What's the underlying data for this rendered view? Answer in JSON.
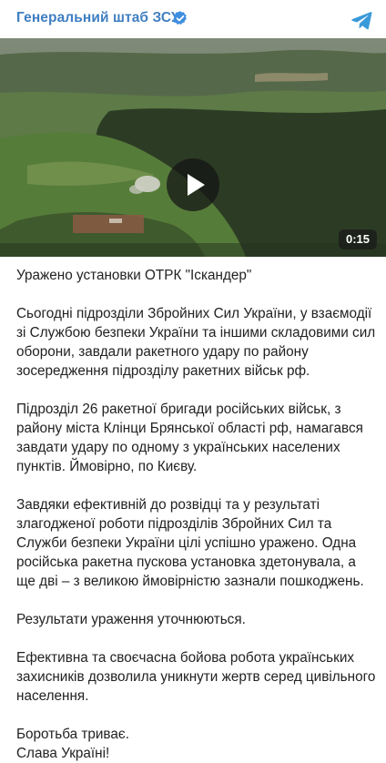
{
  "header": {
    "channel_name": "Генеральний штаб ЗСУ",
    "verified_icon": "verified-badge-icon",
    "share_icon": "telegram-icon",
    "accent_color": "#3f7fc1"
  },
  "video": {
    "duration": "0:15",
    "play_icon": "play-icon"
  },
  "post": {
    "title": "Уражено установки ОТРК \"Іскандер\"",
    "paragraphs": [
      "Сьогодні підрозділи Збройних Сил України, у взаємодії зі Службою безпеки України та іншими складовими сил оборони, завдали ракетного удару по району зосередження підрозділу ракетних військ рф.",
      "Підрозділ 26 ракетної бригади російських військ, з району міста Клінци Брянської області рф, намагався завдати удару по одному з українських населених пунктів. Ймовірно, по Києву.",
      "Завдяки ефективній до розвідці та у результаті злагодженої роботи підрозділів Збройних Сил та Служби безпеки України цілі успішно уражено. Одна російська ракетна пускова установка здетонувала, а ще дві – з великою ймовірністю зазнали пошкоджень.",
      "Результати ураження уточнюються.",
      "Ефективна та своєчасна бойова робота українських захисників дозволила уникнути жертв серед цивільного населення."
    ],
    "closing_lines": [
      "Боротьба триває.",
      "Слава Україні!"
    ]
  }
}
